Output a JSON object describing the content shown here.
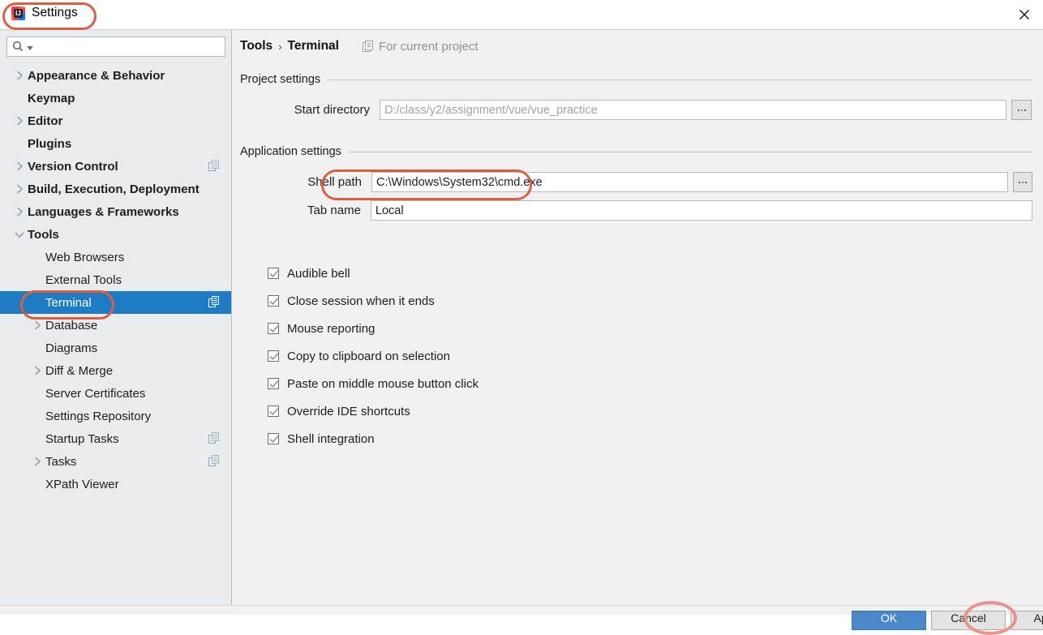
{
  "window": {
    "title": "Settings",
    "app_icon": "intellij-idea-icon",
    "close_icon": "close-icon"
  },
  "search": {
    "value": "",
    "placeholder": "",
    "icon": "search-icon"
  },
  "sidebar": {
    "items": [
      {
        "label": "Appearance & Behavior",
        "arrow": "right",
        "indent": 0,
        "bold": true,
        "selected": false,
        "scope_icon": false
      },
      {
        "label": "Keymap",
        "arrow": "none",
        "indent": 0,
        "bold": true,
        "selected": false,
        "scope_icon": false
      },
      {
        "label": "Editor",
        "arrow": "right",
        "indent": 0,
        "bold": true,
        "selected": false,
        "scope_icon": false
      },
      {
        "label": "Plugins",
        "arrow": "none",
        "indent": 0,
        "bold": true,
        "selected": false,
        "scope_icon": false
      },
      {
        "label": "Version Control",
        "arrow": "right",
        "indent": 0,
        "bold": true,
        "selected": false,
        "scope_icon": true
      },
      {
        "label": "Build, Execution, Deployment",
        "arrow": "right",
        "indent": 0,
        "bold": true,
        "selected": false,
        "scope_icon": false
      },
      {
        "label": "Languages & Frameworks",
        "arrow": "right",
        "indent": 0,
        "bold": true,
        "selected": false,
        "scope_icon": false
      },
      {
        "label": "Tools",
        "arrow": "down",
        "indent": 0,
        "bold": true,
        "selected": false,
        "scope_icon": false
      },
      {
        "label": "Web Browsers",
        "arrow": "none",
        "indent": 1,
        "bold": false,
        "selected": false,
        "scope_icon": false
      },
      {
        "label": "External Tools",
        "arrow": "none",
        "indent": 1,
        "bold": false,
        "selected": false,
        "scope_icon": false
      },
      {
        "label": "Terminal",
        "arrow": "none",
        "indent": 1,
        "bold": false,
        "selected": true,
        "scope_icon": true
      },
      {
        "label": "Database",
        "arrow": "right",
        "indent": 1,
        "bold": false,
        "selected": false,
        "scope_icon": false
      },
      {
        "label": "Diagrams",
        "arrow": "none",
        "indent": 1,
        "bold": false,
        "selected": false,
        "scope_icon": false
      },
      {
        "label": "Diff & Merge",
        "arrow": "right",
        "indent": 1,
        "bold": false,
        "selected": false,
        "scope_icon": false
      },
      {
        "label": "Server Certificates",
        "arrow": "none",
        "indent": 1,
        "bold": false,
        "selected": false,
        "scope_icon": false
      },
      {
        "label": "Settings Repository",
        "arrow": "none",
        "indent": 1,
        "bold": false,
        "selected": false,
        "scope_icon": false
      },
      {
        "label": "Startup Tasks",
        "arrow": "none",
        "indent": 1,
        "bold": false,
        "selected": false,
        "scope_icon": true
      },
      {
        "label": "Tasks",
        "arrow": "right",
        "indent": 1,
        "bold": false,
        "selected": false,
        "scope_icon": true
      },
      {
        "label": "XPath Viewer",
        "arrow": "none",
        "indent": 1,
        "bold": false,
        "selected": false,
        "scope_icon": false
      }
    ]
  },
  "breadcrumb": {
    "parent": "Tools",
    "separator": "›",
    "current": "Terminal",
    "scope_note": "For current project",
    "scope_icon": "project-scope-icon"
  },
  "project_settings": {
    "group_label": "Project settings",
    "start_directory": {
      "label": "Start directory",
      "value": "",
      "placeholder": "D:/class/y2/assignment/vue/vue_practice",
      "browse_label": "..."
    }
  },
  "application_settings": {
    "group_label": "Application settings",
    "shell_path": {
      "label": "Shell path",
      "value": "C:\\Windows\\System32\\cmd.exe",
      "placeholder": "",
      "browse_label": "..."
    },
    "tab_name": {
      "label": "Tab name",
      "value": "Local",
      "placeholder": ""
    },
    "checkboxes": [
      {
        "label": "Audible bell",
        "checked": true
      },
      {
        "label": "Close session when it ends",
        "checked": true
      },
      {
        "label": "Mouse reporting",
        "checked": true
      },
      {
        "label": "Copy to clipboard on selection",
        "checked": true
      },
      {
        "label": "Paste on middle mouse button click",
        "checked": true
      },
      {
        "label": "Override IDE shortcuts",
        "checked": true
      },
      {
        "label": "Shell integration",
        "checked": true
      }
    ]
  },
  "dialog_buttons": [
    {
      "label": "OK",
      "primary": true
    },
    {
      "label": "Cancel",
      "primary": false
    },
    {
      "label": "Apply",
      "primary": false
    }
  ],
  "colors": {
    "selection_blue": "#1f7cc4",
    "sidebar_bg": "#e8ecef",
    "panel_bg": "#f1f1f1",
    "annotation_red": "#d9603f",
    "placeholder_gray": "#a3a3a3"
  },
  "annotations": [
    {
      "name": "settings-title-highlight"
    },
    {
      "name": "terminal-item-highlight"
    },
    {
      "name": "shell-path-highlight"
    },
    {
      "name": "apply-button-highlight"
    }
  ]
}
